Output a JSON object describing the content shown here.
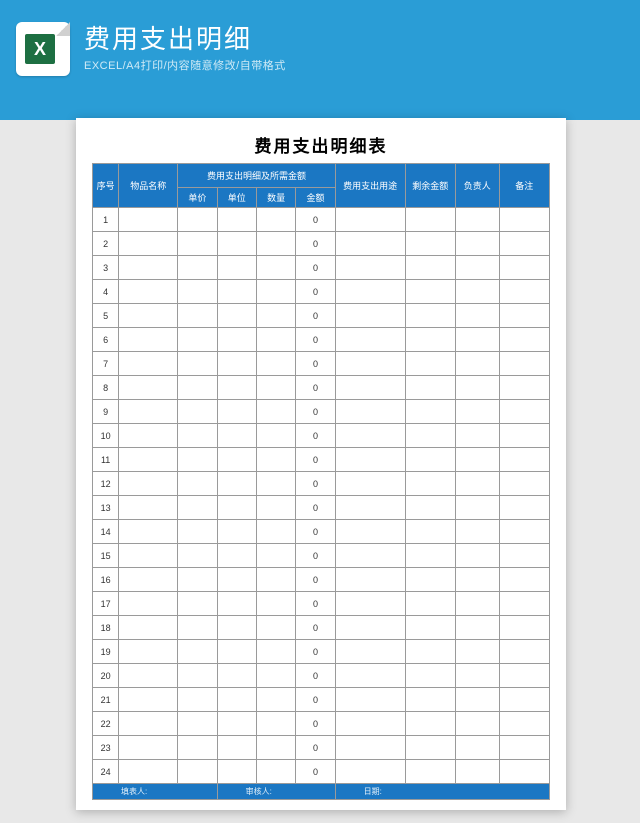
{
  "header": {
    "title": "费用支出明细",
    "subtitle": "EXCEL/A4打印/内容随意修改/自带格式",
    "badge_letter": "X"
  },
  "doc_title": "费用支出明细表",
  "columns": {
    "seq": "序号",
    "name": "物品名称",
    "detail_group": "费用支出明细及所需金额",
    "unit_price": "单价",
    "unit": "单位",
    "qty": "数量",
    "amount": "金额",
    "use": "费用支出用途",
    "balance": "剩余金额",
    "responsible": "负责人",
    "note": "备注"
  },
  "rows": [
    {
      "seq": "1",
      "amount": "0"
    },
    {
      "seq": "2",
      "amount": "0"
    },
    {
      "seq": "3",
      "amount": "0"
    },
    {
      "seq": "4",
      "amount": "0"
    },
    {
      "seq": "5",
      "amount": "0"
    },
    {
      "seq": "6",
      "amount": "0"
    },
    {
      "seq": "7",
      "amount": "0"
    },
    {
      "seq": "8",
      "amount": "0"
    },
    {
      "seq": "9",
      "amount": "0"
    },
    {
      "seq": "10",
      "amount": "0"
    },
    {
      "seq": "11",
      "amount": "0"
    },
    {
      "seq": "12",
      "amount": "0"
    },
    {
      "seq": "13",
      "amount": "0"
    },
    {
      "seq": "14",
      "amount": "0"
    },
    {
      "seq": "15",
      "amount": "0"
    },
    {
      "seq": "16",
      "amount": "0"
    },
    {
      "seq": "17",
      "amount": "0"
    },
    {
      "seq": "18",
      "amount": "0"
    },
    {
      "seq": "19",
      "amount": "0"
    },
    {
      "seq": "20",
      "amount": "0"
    },
    {
      "seq": "21",
      "amount": "0"
    },
    {
      "seq": "22",
      "amount": "0"
    },
    {
      "seq": "23",
      "amount": "0"
    },
    {
      "seq": "24",
      "amount": "0"
    }
  ],
  "footer": {
    "filler": "填表人:",
    "reviewer": "审核人:",
    "date": "日期:"
  }
}
